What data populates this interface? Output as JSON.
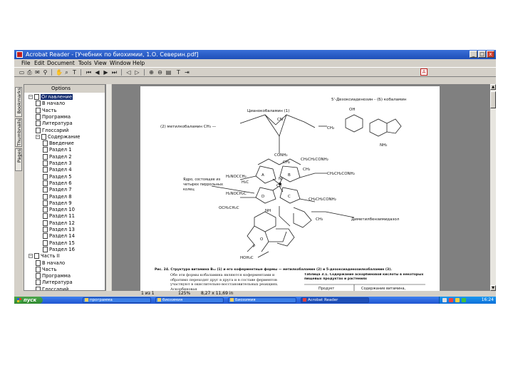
{
  "window": {
    "title": "Acrobat Reader - [Учебник по биохимии, 1.О. Северин.pdf]",
    "icon": "acrobat-icon",
    "controls": [
      "_",
      "□",
      "x"
    ]
  },
  "menu": {
    "items": [
      "File",
      "Edit",
      "Document",
      "Tools",
      "View",
      "Window",
      "Help"
    ]
  },
  "toolbar": {
    "icons": [
      "open-icon",
      "print-icon",
      "email-icon",
      "search-icon",
      "hand-icon",
      "zoom-icon",
      "select-text-icon",
      "first-page-icon",
      "prev-page-icon",
      "next-page-icon",
      "last-page-icon",
      "back-icon",
      "forward-icon",
      "zoom-in-icon",
      "zoom-out-icon",
      "fit-page-icon"
    ],
    "pdf_logo": "A"
  },
  "left_tabs": [
    "Bookmarks",
    "Thumbnails",
    "Pages"
  ],
  "nav": {
    "options_label": "Options"
  },
  "bookmarks": [
    {
      "label": "Оглавление",
      "depth": 0,
      "expanded": true,
      "selected": true
    },
    {
      "label": "В начало",
      "depth": 1
    },
    {
      "label": "Часть",
      "depth": 1
    },
    {
      "label": "Программа",
      "depth": 1
    },
    {
      "label": "Литература",
      "depth": 1
    },
    {
      "label": "Глоссарий",
      "depth": 1
    },
    {
      "label": "Содержание",
      "depth": 1,
      "expanded": true
    },
    {
      "label": "Введение",
      "depth": 2
    },
    {
      "label": "Раздел 1",
      "depth": 2
    },
    {
      "label": "Раздел 2",
      "depth": 2
    },
    {
      "label": "Раздел 3",
      "depth": 2
    },
    {
      "label": "Раздел 4",
      "depth": 2
    },
    {
      "label": "Раздел 5",
      "depth": 2
    },
    {
      "label": "Раздел 6",
      "depth": 2
    },
    {
      "label": "Раздел 7",
      "depth": 2
    },
    {
      "label": "Раздел 8",
      "depth": 2
    },
    {
      "label": "Раздел 9",
      "depth": 2
    },
    {
      "label": "Раздел 10",
      "depth": 2
    },
    {
      "label": "Раздел 11",
      "depth": 2
    },
    {
      "label": "Раздел 12",
      "depth": 2
    },
    {
      "label": "Раздел 13",
      "depth": 2
    },
    {
      "label": "Раздел 14",
      "depth": 2
    },
    {
      "label": "Раздел 15",
      "depth": 2
    },
    {
      "label": "Раздел 16",
      "depth": 2
    },
    {
      "label": "Часть II",
      "depth": 0,
      "expanded": true
    },
    {
      "label": "В начало",
      "depth": 1
    },
    {
      "label": "Часть",
      "depth": 1
    },
    {
      "label": "Программа",
      "depth": 1
    },
    {
      "label": "Литература",
      "depth": 1
    },
    {
      "label": "Глоссарий",
      "depth": 1
    }
  ],
  "page_content": {
    "labels": {
      "b5": "5'-Дезоксиаденозин - (Б) кобаламин",
      "cyano": "Цианокобаламин (1)",
      "methyl": "(2) метилкобаламин CH₃ —",
      "cn": "CN",
      "conh2": "CONH₂",
      "ch2": "CH₂",
      "ch2conh2": "CH₂CH₂CONH₂",
      "h2nocch2": "H₂NOCCH₂",
      "h3c": "H₃C",
      "ch3": "CH₃",
      "co": "Co",
      "a": "A",
      "b": "B",
      "c": "C",
      "d": "D",
      "n": "N",
      "nh": "NH",
      "h2noch2c": "H₂NOCH₂C",
      "coch2ch2": "OCH₂CH₂C",
      "ch2ch2conh2_2": "CH₂CH₂CONH₂",
      "annot1": "Ядро, состоящее из четырех пиррольных колец",
      "annot2": "Диметилбензимидазол",
      "oh": "OH",
      "o": "O",
      "p": "P",
      "hoh2c": "HOH₂C",
      "nh2": "NH₂",
      "ch2_2": "CH₂ —",
      "caption": "Рис. 24. Структура витамина B₁₂ (1) и его коферментные формы — метилкобаламин (2) и 5-дезоксиаденозилкобаламин (3).",
      "para": "Обе эти формы кобаламина являются коферментами и обратимо переходят друг в друга и в составе ферментов участвуют в окислительно-восстановительных реакциях. Аскорбиновая",
      "table_title": "Таблица 3.1. Содержание аскорбиновой кислоты в некоторых пищевых продуктах и растениях",
      "table_h1": "Продукт",
      "table_h2": "Содержание витамина,"
    }
  },
  "status": {
    "page": "1 из 1",
    "zoom": "125%",
    "page_size": "8,27 x 11,69 in"
  },
  "taskbar": {
    "start": "пуск",
    "items": [
      "программа",
      "биохимия",
      "Биохимия",
      "Acrobat Reader"
    ],
    "clock": "16:24"
  }
}
